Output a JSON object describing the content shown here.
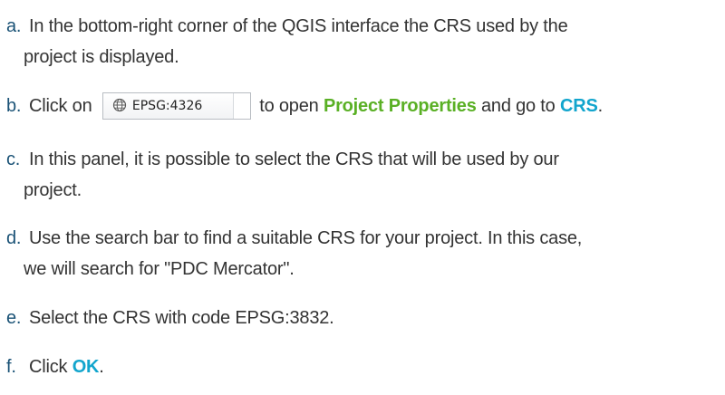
{
  "steps": [
    {
      "marker": "a.",
      "line1": "In the bottom-right corner of the QGIS interface the CRS used by the",
      "line2": "project is displayed."
    },
    {
      "marker": "b.",
      "before": "Click on ",
      "button_label": "EPSG:4326",
      "middle": " to open ",
      "link1": "Project Properties",
      "between": " and go to ",
      "link2": "CRS",
      "after": "."
    },
    {
      "marker": "c.",
      "line1": "In this panel, it is possible to select the CRS that will be used by our",
      "line2": "project."
    },
    {
      "marker": "d.",
      "line1": "Use the search bar to find a suitable CRS for your project. In this case,",
      "line2": "we will search for \"PDC Mercator\"."
    },
    {
      "marker": "e.",
      "line1": "Select the CRS with code EPSG:3832."
    },
    {
      "marker": "f.",
      "before": "Click ",
      "link": "OK",
      "after": "."
    }
  ],
  "colors": {
    "marker": "#1a5276",
    "highlight_green": "#5ab025",
    "highlight_cyan": "#12a5cd",
    "text": "#333333"
  }
}
